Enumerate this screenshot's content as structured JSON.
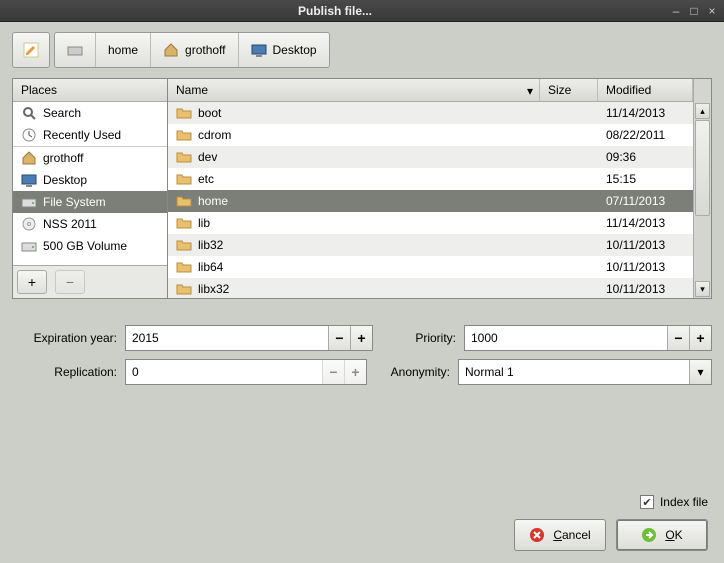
{
  "window": {
    "title": "Publish file..."
  },
  "breadcrumbs": [
    {
      "label": "home"
    },
    {
      "label": "grothoff"
    },
    {
      "label": "Desktop"
    }
  ],
  "places_header": "Places",
  "places": [
    {
      "label": "Search",
      "icon": "search"
    },
    {
      "label": "Recently Used",
      "icon": "clock"
    },
    {
      "label": "grothoff",
      "icon": "home"
    },
    {
      "label": "Desktop",
      "icon": "desktop"
    },
    {
      "label": "File System",
      "icon": "drive",
      "selected": true
    },
    {
      "label": "NSS 2011",
      "icon": "cd"
    },
    {
      "label": "500 GB Volume",
      "icon": "drive"
    }
  ],
  "cols": {
    "name": "Name",
    "size": "Size",
    "modified": "Modified"
  },
  "files": [
    {
      "name": "boot",
      "size": "",
      "modified": "11/14/2013"
    },
    {
      "name": "cdrom",
      "size": "",
      "modified": "08/22/2011"
    },
    {
      "name": "dev",
      "size": "",
      "modified": "09:36"
    },
    {
      "name": "etc",
      "size": "",
      "modified": "15:15"
    },
    {
      "name": "home",
      "size": "",
      "modified": "07/11/2013",
      "selected": true
    },
    {
      "name": "lib",
      "size": "",
      "modified": "11/14/2013"
    },
    {
      "name": "lib32",
      "size": "",
      "modified": "10/11/2013"
    },
    {
      "name": "lib64",
      "size": "",
      "modified": "10/11/2013"
    },
    {
      "name": "libx32",
      "size": "",
      "modified": "10/11/2013"
    }
  ],
  "form": {
    "expiration_label": "Expiration year:",
    "expiration_value": "2015",
    "priority_label": "Priority:",
    "priority_value": "1000",
    "replication_label": "Replication:",
    "replication_value": "0",
    "anonymity_label": "Anonymity:",
    "anonymity_value": "Normal   1"
  },
  "index_file_label": "Index file",
  "index_file_checked": true,
  "buttons": {
    "cancel": "Cancel",
    "ok": "OK"
  }
}
